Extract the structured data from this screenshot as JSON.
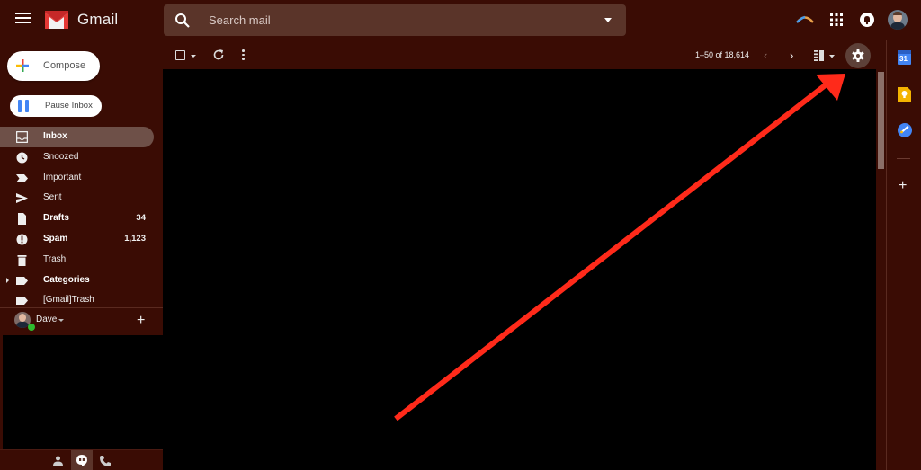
{
  "app": {
    "name": "Gmail",
    "theme_colors": {
      "background": "#3a0c04",
      "search_bg": "#5a3429",
      "active_nav": "#6e5048",
      "annotation_arrow": "#ff2a1a"
    }
  },
  "header": {
    "menu_icon": "hamburger-menu-icon",
    "logo_text": "Gmail",
    "search": {
      "placeholder": "Search mail",
      "icon": "search-icon",
      "options_icon": "caret-down-icon"
    },
    "icons": [
      "rainbow-arc-icon",
      "apps-grid-icon",
      "notifications-bell-icon",
      "account-avatar"
    ]
  },
  "sidebar": {
    "compose_label": "Compose",
    "pause_label": "Pause Inbox",
    "items": [
      {
        "label": "Inbox",
        "count": "",
        "icon": "inbox-icon",
        "active": true,
        "bold": true
      },
      {
        "label": "Snoozed",
        "count": "",
        "icon": "clock-icon",
        "active": false,
        "bold": false
      },
      {
        "label": "Important",
        "count": "",
        "icon": "important-marker-icon",
        "active": false,
        "bold": false
      },
      {
        "label": "Sent",
        "count": "",
        "icon": "send-icon",
        "active": false,
        "bold": false
      },
      {
        "label": "Drafts",
        "count": "34",
        "icon": "draft-file-icon",
        "active": false,
        "bold": true
      },
      {
        "label": "Spam",
        "count": "1,123",
        "icon": "spam-alert-icon",
        "active": false,
        "bold": true
      },
      {
        "label": "Trash",
        "count": "",
        "icon": "trash-icon",
        "active": false,
        "bold": false
      },
      {
        "label": "Categories",
        "count": "",
        "icon": "label-icon",
        "active": false,
        "bold": true
      },
      {
        "label": "[Gmail]Trash",
        "count": "",
        "icon": "label-icon",
        "active": false,
        "bold": false
      }
    ],
    "hangouts_user": {
      "name": "Dave",
      "status": "online"
    },
    "bottom_tabs": [
      "contacts-person-icon",
      "hangouts-chat-icon",
      "phone-call-icon"
    ]
  },
  "toolbar": {
    "pagination": "1–50 of 18,614",
    "prev_icon": "chevron-left-icon",
    "next_icon": "chevron-right-icon",
    "split_pane_icon": "split-pane-icon",
    "settings_icon": "gear-icon"
  },
  "side_panel": {
    "apps": [
      "calendar-icon",
      "keep-icon",
      "tasks-icon"
    ],
    "calendar_day": "31",
    "add_icon": "plus-icon"
  },
  "annotation": {
    "type": "arrow",
    "points_to": "settings-button"
  }
}
